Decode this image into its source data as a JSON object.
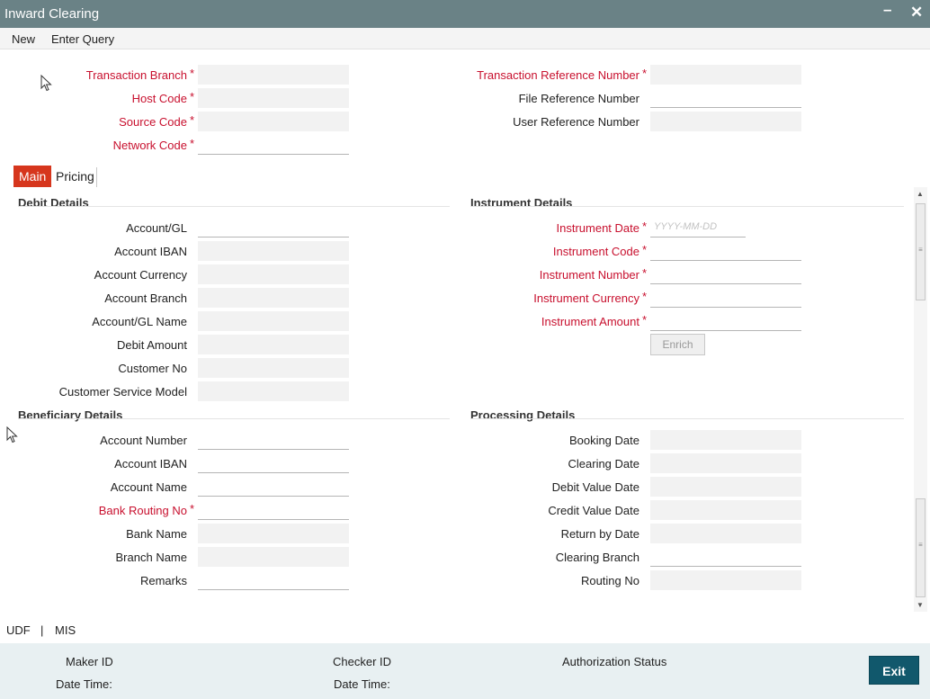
{
  "window": {
    "title": "Inward Clearing",
    "minimize_icon": "minimize-icon",
    "close_icon": "close-icon"
  },
  "menu": {
    "new": "New",
    "enter_query": "Enter Query"
  },
  "header_fields": {
    "transaction_branch": {
      "label": "Transaction Branch",
      "value": ""
    },
    "host_code": {
      "label": "Host Code",
      "value": ""
    },
    "source_code": {
      "label": "Source Code",
      "value": ""
    },
    "network_code": {
      "label": "Network Code",
      "value": ""
    },
    "transaction_reference_number": {
      "label": "Transaction Reference Number",
      "value": ""
    },
    "file_reference_number": {
      "label": "File Reference Number",
      "value": ""
    },
    "user_reference_number": {
      "label": "User Reference Number",
      "value": ""
    }
  },
  "tabs": [
    {
      "label": "Main",
      "active": true
    },
    {
      "label": "Pricing",
      "active": false
    }
  ],
  "debit_details": {
    "heading": "Debit Details",
    "account_gl": "Account/GL",
    "account_iban": "Account IBAN",
    "account_currency": "Account Currency",
    "account_branch": "Account Branch",
    "account_gl_name": "Account/GL Name",
    "debit_amount": "Debit Amount",
    "customer_no": "Customer No",
    "customer_service_model": "Customer Service Model"
  },
  "instrument_details": {
    "heading": "Instrument Details",
    "instrument_date": "Instrument Date",
    "instrument_date_placeholder": "YYYY-MM-DD",
    "instrument_code": "Instrument Code",
    "instrument_number": "Instrument Number",
    "instrument_currency": "Instrument Currency",
    "instrument_amount": "Instrument Amount",
    "enrich_button": "Enrich"
  },
  "beneficiary_details": {
    "heading": "Beneficiary Details",
    "account_number": "Account Number",
    "account_iban": "Account IBAN",
    "account_name": "Account Name",
    "bank_routing_no": "Bank Routing No",
    "bank_name": "Bank Name",
    "branch_name": "Branch Name",
    "remarks": "Remarks"
  },
  "processing_details": {
    "heading": "Processing Details",
    "booking_date": "Booking Date",
    "clearing_date": "Clearing Date",
    "debit_value_date": "Debit Value Date",
    "credit_value_date": "Credit Value Date",
    "return_by_date": "Return by Date",
    "clearing_branch": "Clearing Branch",
    "routing_no": "Routing No"
  },
  "bottom_links": {
    "udf": "UDF",
    "separator": "|",
    "mis": "MIS"
  },
  "footer": {
    "maker_id": "Maker ID",
    "date_time_1": "Date Time:",
    "checker_id": "Checker ID",
    "date_time_2": "Date Time:",
    "authorization_status": "Authorization Status",
    "exit_button": "Exit"
  },
  "required_marker": "*",
  "colors": {
    "titlebar": "#6a8286",
    "required": "#c8102e",
    "active_tab": "#d6361d",
    "exit_button": "#11586c",
    "footer": "#e8f0f2"
  }
}
